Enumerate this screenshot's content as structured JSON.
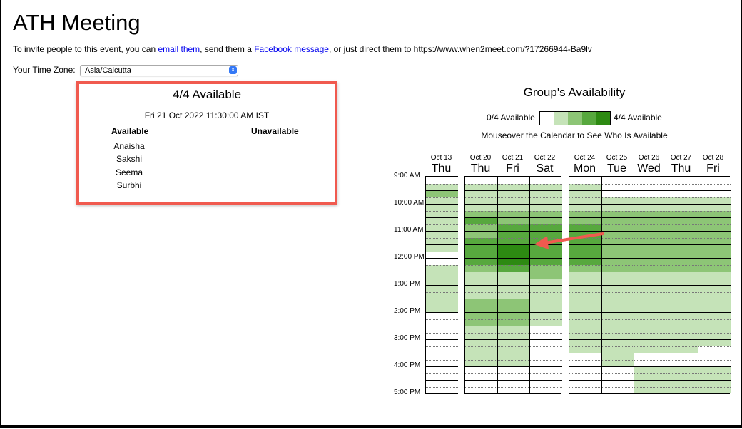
{
  "page": {
    "title": "ATH Meeting",
    "invite_prefix": "To invite people to this event, you can ",
    "email_link": "email them",
    "invite_mid": ", send them a ",
    "fb_link": "Facebook message",
    "invite_suffix": ", or just direct them to https://www.when2meet.com/?17266944-Ba9lv",
    "tz_label": "Your Time Zone:",
    "tz_value": "Asia/Calcutta"
  },
  "detail": {
    "count": "4/4 Available",
    "time": "Fri 21 Oct 2022 11:30:00 AM IST",
    "available_header": "Available",
    "unavailable_header": "Unavailable",
    "available": [
      "Anaisha",
      "Sakshi",
      "Seema",
      "Surbhi"
    ]
  },
  "group": {
    "title": "Group's Availability",
    "legend_min": "0/4 Available",
    "legend_max": "4/4 Available",
    "legend_colors": [
      "#ffffff",
      "#c5e3b8",
      "#8dc576",
      "#57a83e",
      "#2d8a12"
    ],
    "mouseover": "Mouseover the Calendar to See Who Is Available"
  },
  "calendar": {
    "colors": [
      "#ffffff",
      "#c5e3b8",
      "#8dc576",
      "#57a83e",
      "#2d8a12"
    ],
    "times": [
      "9:00 AM",
      "10:00 AM",
      "11:00 AM",
      "12:00 PM",
      "1:00 PM",
      "2:00 PM",
      "3:00 PM",
      "4:00 PM",
      "5:00 PM"
    ],
    "days": [
      {
        "date": "Oct 13",
        "dow": "Thu",
        "levels": [
          0,
          1,
          2,
          1,
          1,
          1,
          1,
          1,
          1,
          1,
          1,
          0,
          0,
          1,
          1,
          1,
          1,
          1,
          1,
          1,
          0,
          0,
          0,
          0,
          0,
          0,
          0,
          0,
          0,
          0,
          0,
          0
        ]
      },
      {
        "date": "Oct 20",
        "dow": "Thu",
        "levels": [
          0,
          1,
          1,
          1,
          1,
          2,
          3,
          2,
          2,
          3,
          3,
          3,
          3,
          2,
          1,
          1,
          1,
          1,
          2,
          2,
          2,
          2,
          1,
          1,
          1,
          1,
          1,
          1,
          0,
          0,
          0,
          0
        ]
      },
      {
        "date": "Oct 21",
        "dow": "Fri",
        "levels": [
          0,
          1,
          1,
          1,
          1,
          2,
          2,
          3,
          3,
          3,
          4,
          4,
          4,
          3,
          1,
          1,
          1,
          1,
          2,
          2,
          2,
          2,
          1,
          1,
          1,
          1,
          1,
          1,
          0,
          0,
          0,
          0
        ]
      },
      {
        "date": "Oct 22",
        "dow": "Sat",
        "levels": [
          0,
          1,
          1,
          1,
          1,
          2,
          2,
          3,
          3,
          3,
          3,
          3,
          3,
          2,
          2,
          1,
          1,
          1,
          1,
          1,
          1,
          1,
          0,
          0,
          0,
          0,
          0,
          0,
          0,
          0,
          0,
          0
        ]
      },
      {
        "date": "Oct 24",
        "dow": "Mon",
        "levels": [
          0,
          1,
          1,
          1,
          1,
          2,
          2,
          3,
          3,
          3,
          3,
          3,
          3,
          2,
          1,
          1,
          1,
          1,
          1,
          1,
          1,
          1,
          1,
          1,
          1,
          1,
          0,
          0,
          0,
          0,
          0,
          0
        ]
      },
      {
        "date": "Oct 25",
        "dow": "Tue",
        "levels": [
          0,
          0,
          0,
          1,
          1,
          2,
          2,
          2,
          2,
          2,
          2,
          2,
          2,
          2,
          1,
          1,
          1,
          1,
          1,
          1,
          1,
          1,
          1,
          1,
          1,
          1,
          1,
          1,
          0,
          0,
          0,
          0
        ]
      },
      {
        "date": "Oct 26",
        "dow": "Wed",
        "levels": [
          0,
          0,
          0,
          1,
          1,
          2,
          2,
          2,
          2,
          2,
          2,
          2,
          2,
          2,
          1,
          1,
          1,
          1,
          1,
          1,
          1,
          1,
          1,
          1,
          1,
          1,
          0,
          0,
          1,
          1,
          1,
          1
        ]
      },
      {
        "date": "Oct 27",
        "dow": "Thu",
        "levels": [
          0,
          0,
          0,
          1,
          1,
          2,
          2,
          2,
          2,
          2,
          2,
          2,
          2,
          2,
          1,
          1,
          1,
          1,
          1,
          1,
          1,
          1,
          1,
          1,
          1,
          1,
          0,
          0,
          1,
          1,
          1,
          1
        ]
      },
      {
        "date": "Oct 28",
        "dow": "Fri",
        "levels": [
          0,
          0,
          0,
          1,
          1,
          2,
          2,
          2,
          2,
          2,
          2,
          2,
          2,
          2,
          1,
          1,
          1,
          1,
          1,
          1,
          1,
          1,
          1,
          1,
          1,
          0,
          0,
          0,
          1,
          1,
          1,
          1
        ]
      }
    ]
  }
}
